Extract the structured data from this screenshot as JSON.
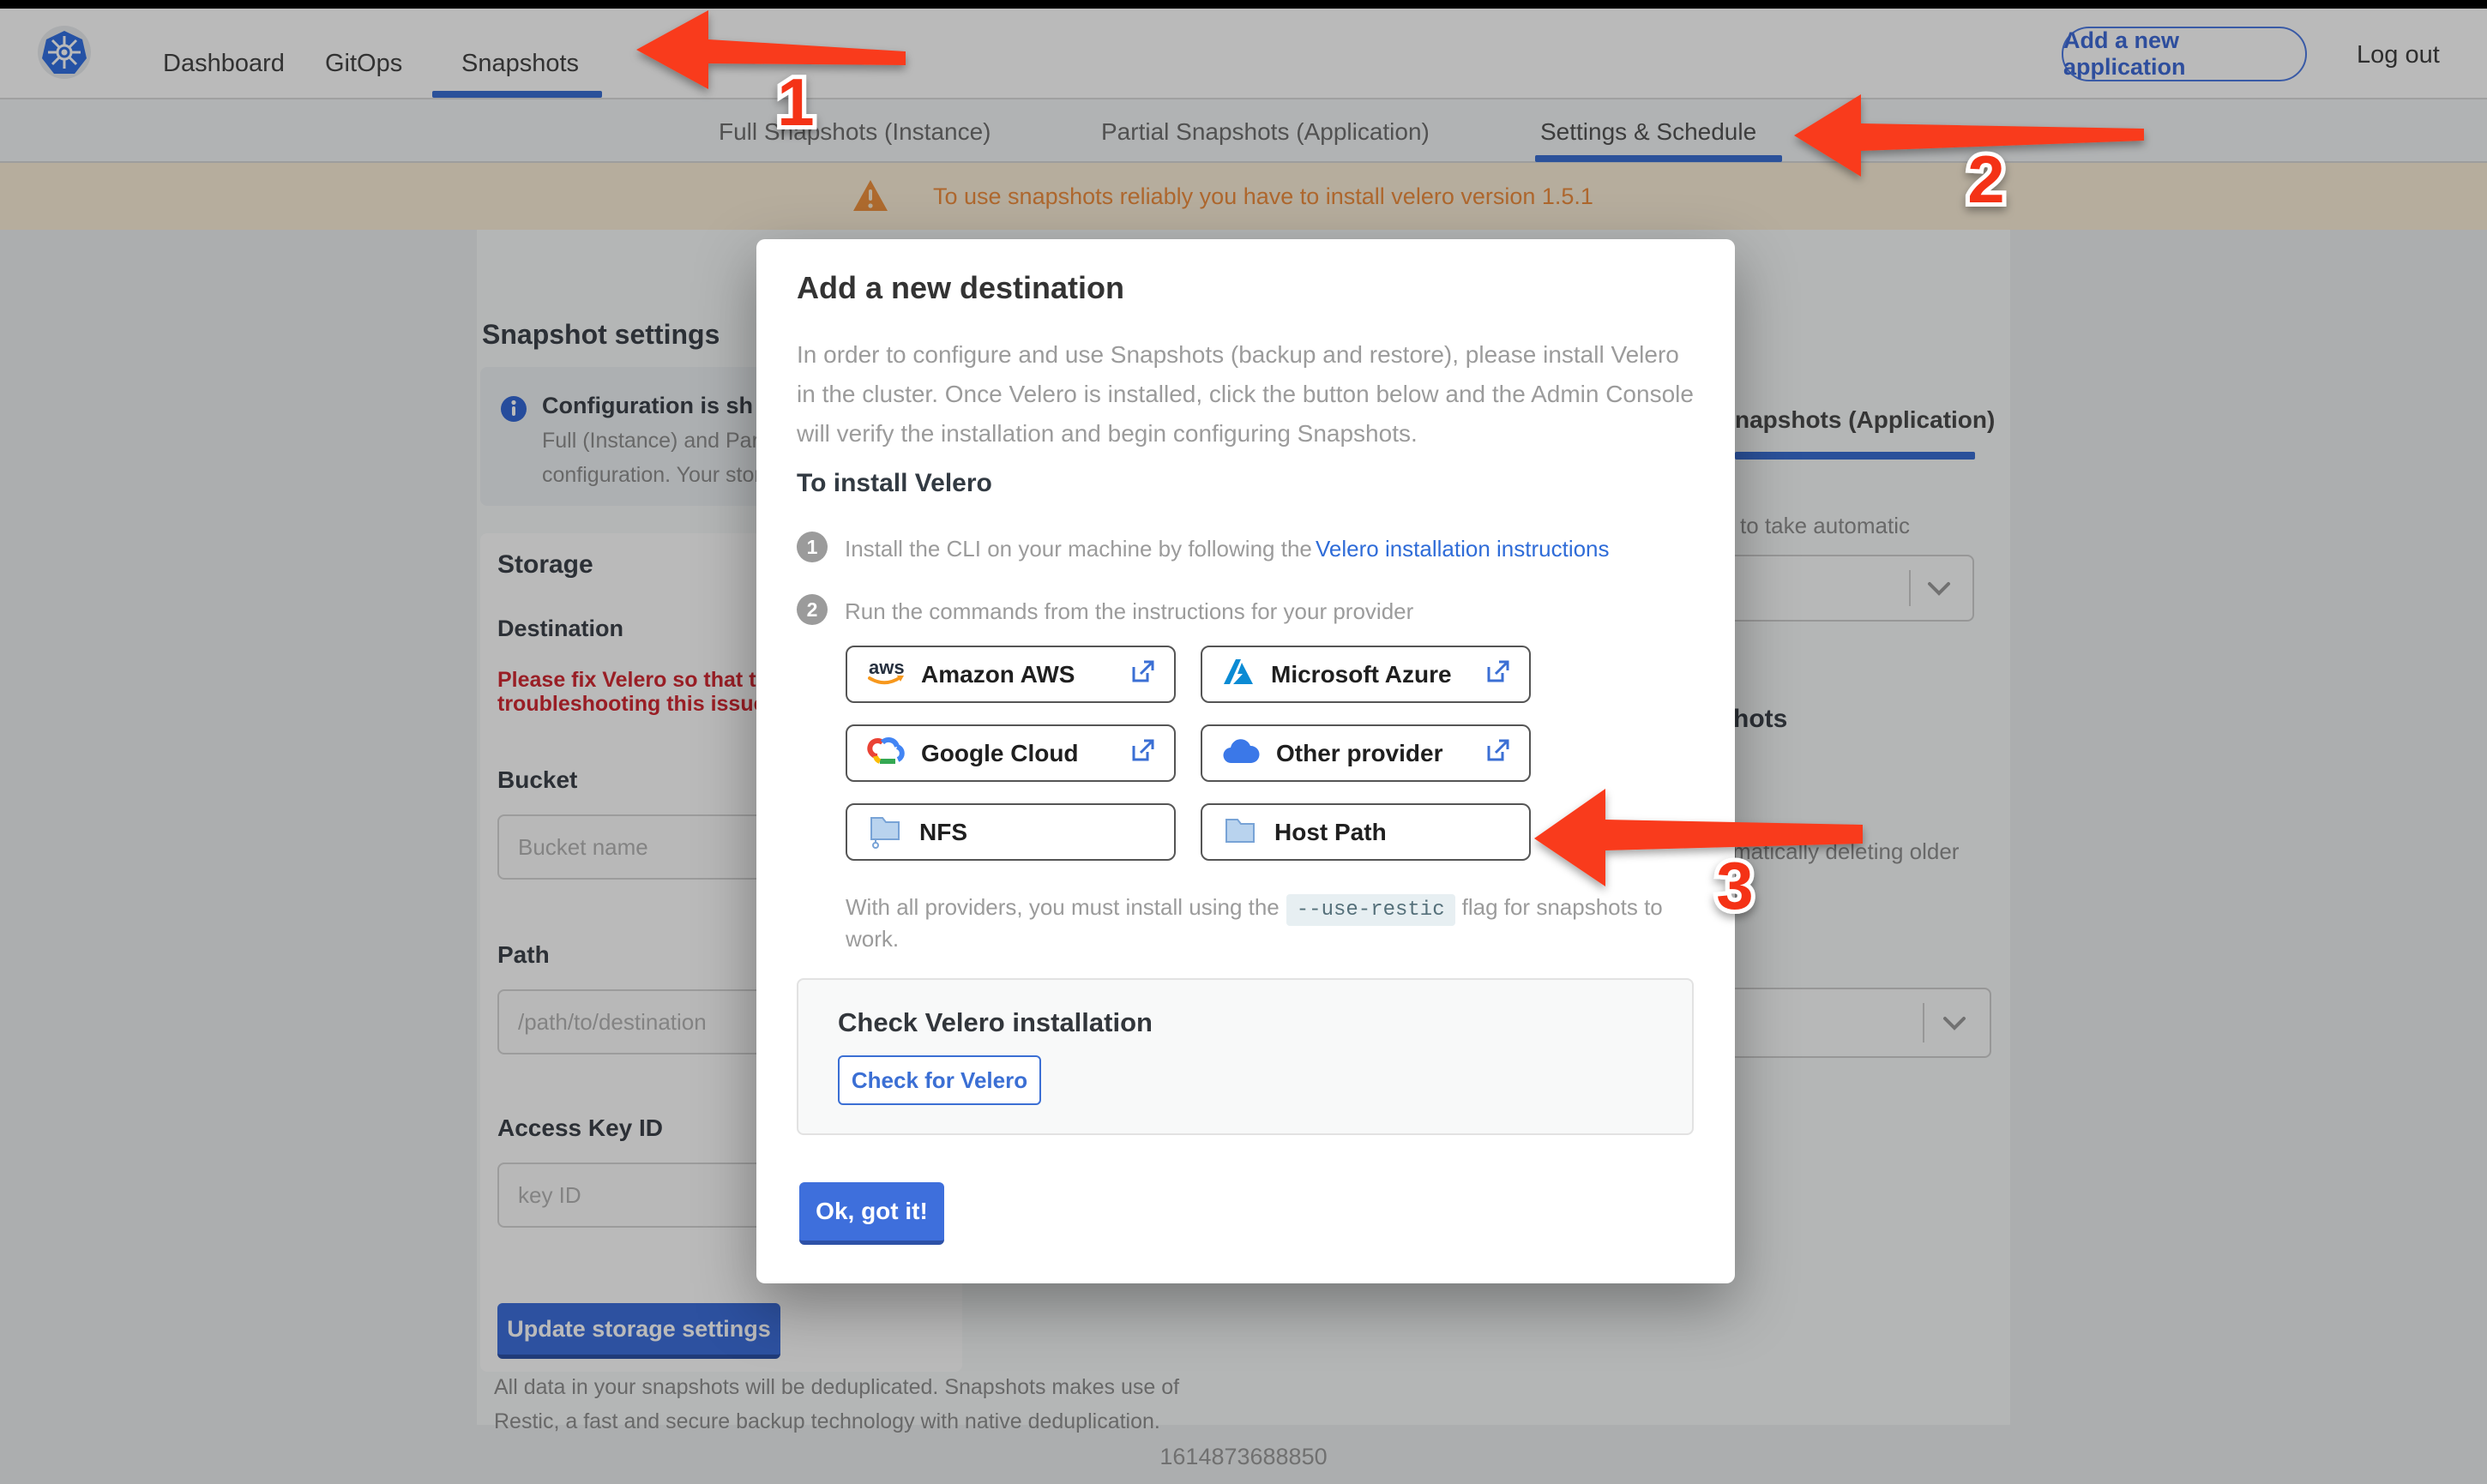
{
  "header": {
    "nav": [
      {
        "label": "Dashboard"
      },
      {
        "label": "GitOps"
      },
      {
        "label": "Snapshots"
      }
    ],
    "add_app_label": "Add a new application",
    "logout_label": "Log out"
  },
  "tabs": [
    {
      "label": "Full Snapshots (Instance)"
    },
    {
      "label": "Partial Snapshots (Application)"
    },
    {
      "label": "Settings & Schedule"
    }
  ],
  "banner": {
    "text": "To use snapshots reliably you have to install velero version 1.5.1"
  },
  "left_panel": {
    "title": "Snapshot settings",
    "info": {
      "title_partial": "Configuration is sh",
      "line1_partial": "Full (Instance) and Parti",
      "line2_partial": "configuration. Your stor"
    },
    "storage": {
      "heading": "Storage",
      "destination_label": "Destination",
      "error_line1": "Please fix Velero so that th",
      "error_line2": "troubleshooting this issue",
      "bucket_label": "Bucket",
      "bucket_placeholder": "Bucket name",
      "path_label": "Path",
      "path_placeholder": "/path/to/destination",
      "access_key_label": "Access Key ID",
      "access_key_placeholder": "key ID",
      "update_button": "Update storage settings"
    },
    "footnote_line1": "All data in your snapshots will be deduplicated. Snapshots makes use of",
    "footnote_line2": "Restic, a fast and secure backup technology with native deduplication."
  },
  "right_panel": {
    "tab_partial": "napshots (Application)",
    "text1_partial": "to take automatic",
    "heading_partial": "hots",
    "text2_partial": "matically deleting older"
  },
  "modal": {
    "title": "Add a new destination",
    "intro": "In order to configure and use Snapshots (backup and restore), please install Velero in the cluster. Once Velero is installed, click the button below and the Admin Console will verify the installation and begin configuring Snapshots.",
    "install_heading": "To install Velero",
    "steps": [
      {
        "num": "1",
        "text": "Install the CLI on your machine by following the",
        "link": "Velero installation instructions"
      },
      {
        "num": "2",
        "text": "Run the commands from the instructions for your provider"
      }
    ],
    "providers": [
      {
        "label": "Amazon AWS",
        "icon": "aws-logo"
      },
      {
        "label": "Microsoft Azure",
        "icon": "azure-logo"
      },
      {
        "label": "Google Cloud",
        "icon": "google-cloud-logo"
      },
      {
        "label": "Other provider",
        "icon": "cloud-icon"
      },
      {
        "label": "NFS",
        "icon": "network-folder-icon"
      },
      {
        "label": "Host Path",
        "icon": "folder-icon"
      }
    ],
    "restic_note_prefix": "With all providers, you must install using the",
    "restic_flag": "--use-restic",
    "restic_note_suffix": "flag for snapshots to work.",
    "check": {
      "heading": "Check Velero installation",
      "button": "Check for Velero"
    },
    "ok_button": "Ok, got it!"
  },
  "footer": {
    "timestamp": "1614873688850"
  },
  "annotations": {
    "numbers": [
      "1",
      "2",
      "3"
    ],
    "arrow_color": "#f93b1d"
  },
  "colors": {
    "accent_blue": "#3b6fd4",
    "primary_button": "#3e6fdc",
    "banner_text": "#ef8e3f",
    "error_red": "#d22a33",
    "arrow_red": "#f93b1d"
  }
}
